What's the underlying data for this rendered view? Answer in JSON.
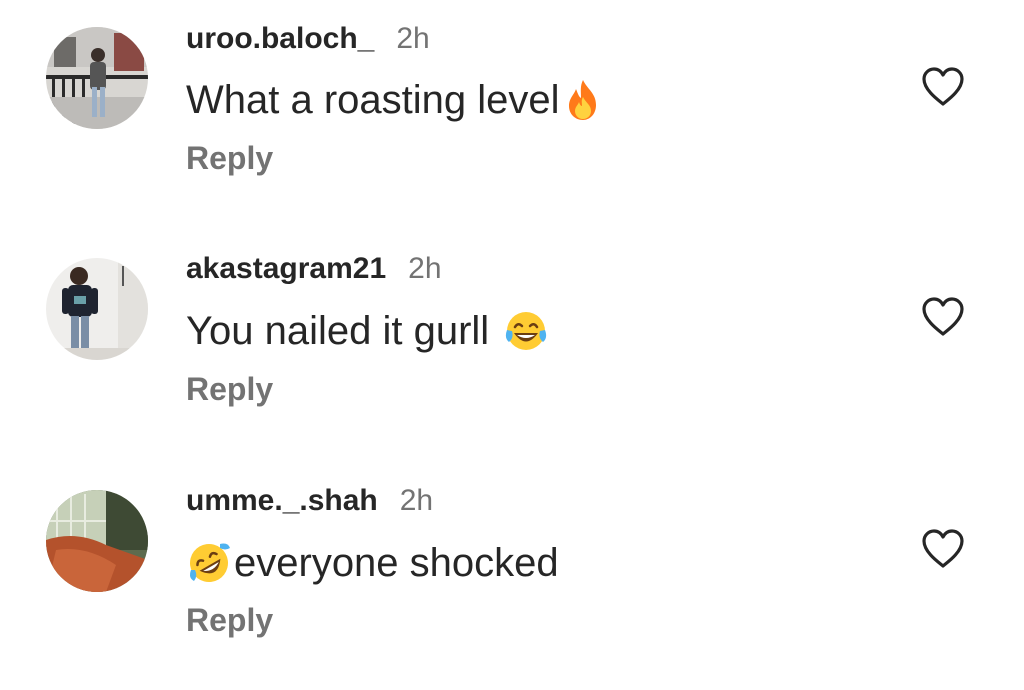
{
  "comments": [
    {
      "username": "uroo.baloch_",
      "time": "2h",
      "text": "What a roasting level",
      "emoji": "fire-emoji",
      "emoji_position": "end",
      "reply_label": "Reply",
      "liked": false
    },
    {
      "username": "akastagram21",
      "time": "2h",
      "text": "You nailed it gurll",
      "emoji": "tears-of-joy-emoji",
      "emoji_position": "end",
      "reply_label": "Reply",
      "liked": false
    },
    {
      "username": "umme._.shah",
      "time": "2h",
      "text": "everyone shocked",
      "emoji": "rolling-on-floor-laughing-emoji",
      "emoji_position": "start",
      "reply_label": "Reply",
      "liked": false
    }
  ],
  "colors": {
    "text_primary": "#262626",
    "text_secondary": "#737373",
    "background": "#ffffff"
  }
}
